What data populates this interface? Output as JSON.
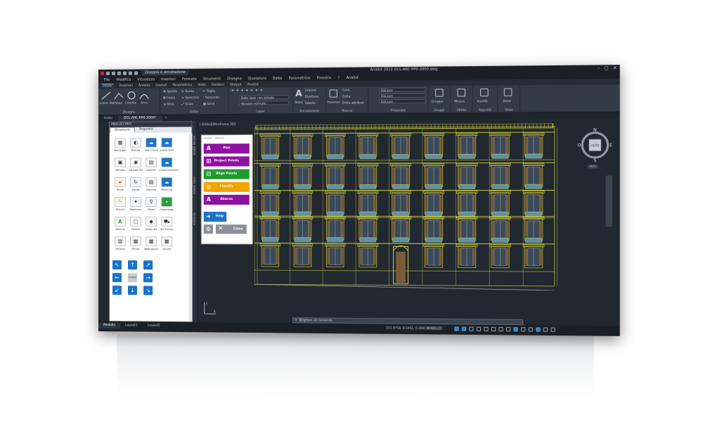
{
  "titlebar": {
    "workspace": "Disegno e annotazione",
    "title": "Analist 2022   DCL-ARC-PP0-2000.dwg"
  },
  "menubar": [
    "File",
    "Modifica",
    "Visualizza",
    "Inserisci",
    "Formato",
    "Strumenti",
    "Disegna",
    "Quotatura",
    "Edita",
    "Parametrico",
    "Finestra",
    "?",
    "Analist"
  ],
  "ribbon_tabs": [
    "Inizio",
    "Inserisci",
    "Annota",
    "Layout",
    "Parametrico",
    "Vista",
    "Gestisci",
    "Output",
    "Analist"
  ],
  "ribbon": {
    "draw": {
      "label": "Disegno",
      "items": [
        "Linea",
        "Polilinea",
        "Cerchio",
        "Arco"
      ]
    },
    "edit": {
      "label": "Edita",
      "items": [
        "Sposta",
        "Ruota",
        "Taglia",
        "Copia",
        "Specchio",
        "Raccordo",
        "Stira",
        "Scala",
        "Serie"
      ]
    },
    "layer": {
      "label": "Layer",
      "dd1": "Stato layer non salvato",
      "dd2": "descaxo verticale"
    },
    "annotation": {
      "label": "Annotazione",
      "items": [
        "Testo",
        "Lineare",
        "Direttore",
        "Tabella"
      ]
    },
    "block": {
      "label": "Blocco",
      "items": [
        "Inserisci",
        "Crea",
        "Edita",
        "Edita attributi"
      ]
    },
    "properties": {
      "label": "Proprietà",
      "dd1": "DaLayer",
      "dd2": "DaLayer",
      "dd3": "DaLayer"
    },
    "groups": {
      "label": "Gruppi",
      "items": [
        "Gruppo"
      ]
    },
    "utility": {
      "label": "Utilità",
      "items": [
        "Misura"
      ]
    },
    "clipboard": {
      "label": "Appunti",
      "items": [
        "Incolla"
      ]
    },
    "view": {
      "label": "Vista",
      "items": [
        "Base"
      ]
    }
  },
  "doctabs": [
    "Inizio",
    "DCL-ARC-PP0-2000*"
  ],
  "palette": {
    "header": "ANALIST PRO",
    "tabs": [
      "Strumenti",
      "Proprietà"
    ],
    "items": [
      {
        "label": "Blocklign",
        "glyph": "▦"
      },
      {
        "label": "ReCap",
        "glyph": "◐"
      },
      {
        "label": "Get Cloud",
        "glyph": "☁"
      },
      {
        "label": "Cloud Sect",
        "glyph": "☁"
      },
      {
        "label": "Attivaa",
        "glyph": "▣"
      },
      {
        "label": "Attivaa 3D",
        "glyph": "◉"
      },
      {
        "label": "Geocell",
        "glyph": "▤"
      },
      {
        "label": "Cloud Explorer",
        "glyph": "☁"
      },
      {
        "label": "Scala",
        "glyph": "▰"
      },
      {
        "label": "Ruota",
        "glyph": "↻"
      },
      {
        "label": "Decima",
        "glyph": "▨"
      },
      {
        "label": "Meshing",
        "glyph": "☁"
      },
      {
        "label": "Misure",
        "glyph": "✎"
      },
      {
        "label": "Rigenera",
        "glyph": "✦"
      },
      {
        "label": "Zoom",
        "glyph": "⚲"
      },
      {
        "label": "Geoimage",
        "glyph": "⌖"
      },
      {
        "label": "Abacus",
        "glyph": "A"
      },
      {
        "label": "Frame",
        "glyph": "▢"
      },
      {
        "label": "Snap 3D",
        "glyph": "◆"
      },
      {
        "label": "3D Printer",
        "glyph": "⛟"
      },
      {
        "label": "Vertice",
        "glyph": "▥"
      },
      {
        "label": "Photo",
        "glyph": "▦"
      },
      {
        "label": "Webreport",
        "glyph": "▩"
      },
      {
        "label": "2D/3D",
        "glyph": "▩"
      }
    ],
    "nav_center": "Analist"
  },
  "vtabs": [
    "Analist Modelli",
    "Analist Cloud",
    "Ambiente"
  ],
  "viewport_label": "[-][Sito][Wireframe 2D]",
  "analist_panel": {
    "header": "Analist · Abacus",
    "buttons": [
      {
        "label": "Plot",
        "color": "#8e12a0",
        "glyph": "A"
      },
      {
        "label": "Project Points",
        "color": "#8e12a0",
        "glyph": "⊞"
      },
      {
        "label": "Align Points",
        "color": "#1f9a2e",
        "glyph": "⊟"
      },
      {
        "label": "Classify",
        "color": "#f2a300",
        "glyph": "◎"
      },
      {
        "label": "Abacus",
        "color": "#8e12a0",
        "glyph": "A"
      }
    ],
    "help": "Help",
    "close": "Close"
  },
  "viewcube": {
    "n": "N",
    "s": "S",
    "e": "E",
    "w": "O",
    "face": "ALTO",
    "wcs": "WCS"
  },
  "command_placeholder": "Digitare un comando",
  "status": {
    "layouts": [
      "Modello",
      "Layout1",
      "Layout2"
    ],
    "coords": "151.6718, 8.5461, 0.0000",
    "mode": "MODELLO"
  },
  "colors": {
    "accent": "#4aa3df",
    "facade": "#e8e33a",
    "window": "#5c8fb0",
    "shutter": "#7a5a38"
  }
}
